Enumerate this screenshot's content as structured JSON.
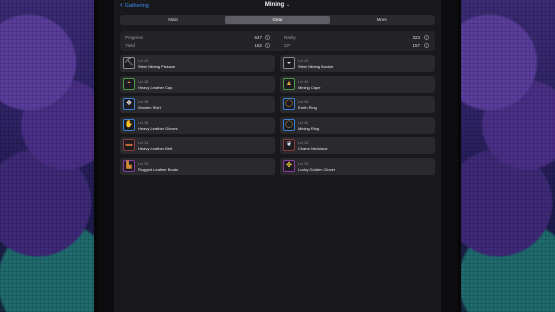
{
  "nav": {
    "back_label": "Gathering",
    "title": "Mining"
  },
  "tabs": [
    {
      "label": "Main",
      "active": false
    },
    {
      "label": "Gear",
      "active": true
    },
    {
      "label": "More",
      "active": false
    }
  ],
  "stats": [
    {
      "label": "Progress",
      "value": "647"
    },
    {
      "label": "Rarity",
      "value": "323"
    },
    {
      "label": "Yield",
      "value": "162"
    },
    {
      "label": "CP",
      "value": "157"
    }
  ],
  "gear": [
    {
      "level": "Lvl. 40",
      "name": "Steel Mining Pickaxe",
      "icon": "pickaxe-icon",
      "glyph": "⛏",
      "border": "#8a8a92",
      "color": "#c9c9d0"
    },
    {
      "level": "Lvl. 40",
      "name": "Steel Mining Bucket",
      "icon": "bucket-icon",
      "glyph": "◒",
      "border": "#8a8a92",
      "color": "#e0e0e6"
    },
    {
      "level": "Lvl. 38",
      "name": "Heavy Leather Cap",
      "icon": "cap-icon",
      "glyph": "◓",
      "border": "#4a9a46",
      "color": "#d08a3a"
    },
    {
      "level": "Lvl. 40",
      "name": "Mining Cape",
      "icon": "cape-icon",
      "glyph": "▲",
      "border": "#4a9a46",
      "color": "#d6a63a"
    },
    {
      "level": "Lvl. 38",
      "name": "Woolen Shirt",
      "icon": "shirt-icon",
      "glyph": "❖",
      "border": "#3b7fd4",
      "color": "#e8e8ee"
    },
    {
      "level": "Lvl. 40",
      "name": "Earth Ring",
      "icon": "ring-icon",
      "glyph": "◯",
      "border": "#3b7fd4",
      "color": "#d8963a"
    },
    {
      "level": "Lvl. 38",
      "name": "Heavy Leather Gloves",
      "icon": "gloves-icon",
      "glyph": "✋",
      "border": "#3b7fd4",
      "color": "#d08a3a"
    },
    {
      "level": "Lvl. 40",
      "name": "Mining Ring",
      "icon": "ring-icon",
      "glyph": "◯",
      "border": "#3b7fd4",
      "color": "#c8a050"
    },
    {
      "level": "Lvl. 34",
      "name": "Heavy Leather Belt",
      "icon": "belt-icon",
      "glyph": "▬",
      "border": "#8a3a3a",
      "color": "#c06a3a"
    },
    {
      "level": "Lvl. 30",
      "name": "Charm Necklace",
      "icon": "necklace-icon",
      "glyph": "❦",
      "border": "#8a3a3a",
      "color": "#e0e0e6"
    },
    {
      "level": "Lvl. 30",
      "name": "Rugged Leather Boots",
      "icon": "boots-icon",
      "glyph": "▙",
      "border": "#8a3aa0",
      "color": "#d08a3a"
    },
    {
      "level": "Lvl. 30",
      "name": "Lucky Golden Clover",
      "icon": "clover-icon",
      "glyph": "✤",
      "border": "#8a3aa0",
      "color": "#e8c43a"
    }
  ]
}
